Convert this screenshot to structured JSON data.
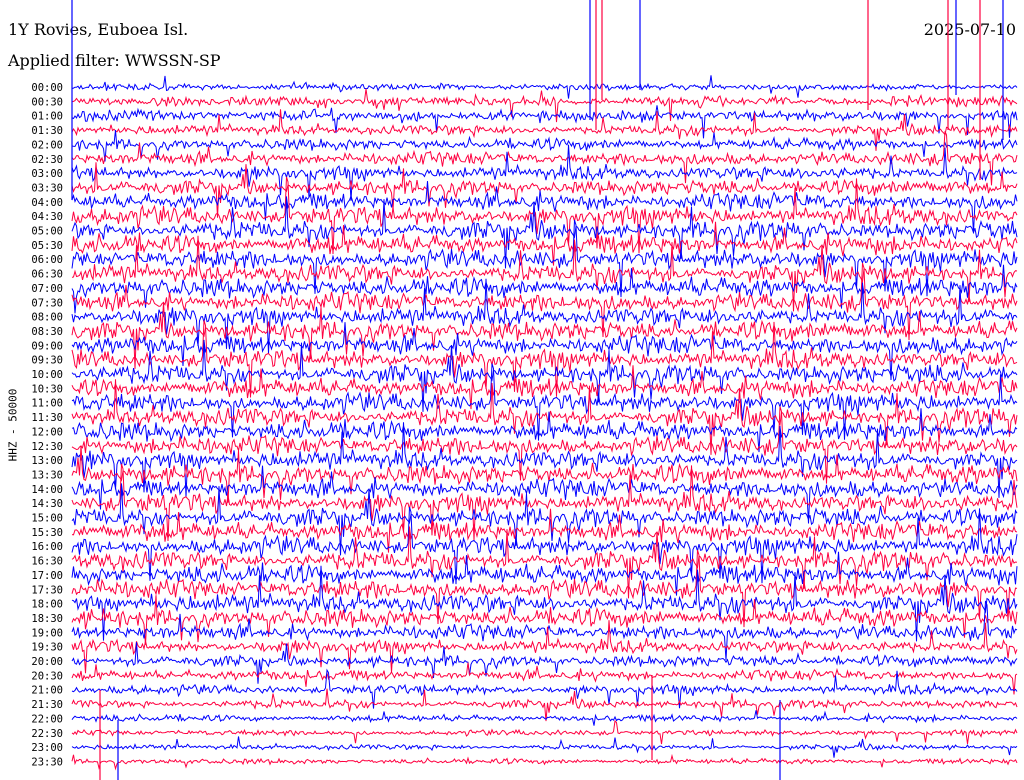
{
  "header": {
    "station": "1Y Rovies, Euboea Isl.",
    "date": "2025-07-10",
    "filter": "Applied filter: WWSSN-SP"
  },
  "channel_label": "HHZ - 50000",
  "colors": {
    "trace_a": "#0000ff",
    "trace_b": "#ff0040",
    "background": "#ffffff",
    "text": "#000000"
  },
  "chart_data": {
    "type": "line",
    "subtype": "helicorder",
    "title": "1Y Rovies, Euboea Isl.",
    "date": "2025-07-10",
    "ylabel": "HHZ - 50000",
    "traces_per_row_color_cycle": [
      "#0000ff",
      "#ff0040"
    ],
    "row_labels": [
      "00:00",
      "00:30",
      "01:00",
      "01:30",
      "02:00",
      "02:30",
      "03:00",
      "03:30",
      "04:00",
      "04:30",
      "05:00",
      "05:30",
      "06:00",
      "06:30",
      "07:00",
      "07:30",
      "08:00",
      "08:30",
      "09:00",
      "09:30",
      "10:00",
      "10:30",
      "11:00",
      "11:30",
      "12:00",
      "12:30",
      "13:00",
      "13:30",
      "14:00",
      "14:30",
      "15:00",
      "15:30",
      "16:00",
      "16:30",
      "17:00",
      "17:30",
      "18:00",
      "18:30",
      "19:00",
      "19:30",
      "20:00",
      "20:30",
      "21:00",
      "21:30",
      "22:00",
      "22:30",
      "23:00",
      "23:30"
    ],
    "relative_amplitude": [
      0.35,
      0.55,
      0.6,
      0.55,
      0.6,
      0.7,
      0.75,
      0.8,
      0.9,
      1.0,
      1.0,
      1.0,
      1.0,
      1.0,
      1.0,
      1.0,
      1.0,
      1.0,
      1.0,
      1.0,
      1.0,
      1.0,
      1.0,
      1.0,
      1.0,
      1.0,
      1.0,
      1.0,
      1.0,
      1.0,
      1.0,
      1.0,
      1.0,
      1.0,
      1.0,
      1.0,
      1.0,
      0.95,
      0.8,
      0.7,
      0.6,
      0.55,
      0.5,
      0.45,
      0.35,
      0.3,
      0.28,
      0.28
    ]
  }
}
